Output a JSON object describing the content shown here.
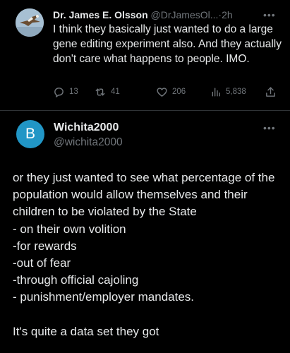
{
  "tweet1": {
    "author_name": "Dr. James E. Olsson",
    "handle": "@DrJamesOl...",
    "separator": "·",
    "time": "2h",
    "more_icon": "more-horizontal-icon",
    "text": "I think they basically just wanted to do a large gene editing experiment also. And they actually don't care what happens to people. IMO.",
    "actions": {
      "replies": "13",
      "retweets": "41",
      "likes": "206",
      "views": "5,838"
    }
  },
  "tweet2": {
    "avatar_letter": "B",
    "author_name": "Wichita2000",
    "handle": "@wichita2000",
    "more_icon": "more-horizontal-icon",
    "text": "or they just wanted to see what percentage of the population would allow themselves and their children to be violated by the State\n- on their own volition\n-for rewards\n-out of fear\n-through official cajoling\n- punishment/employer mandates.\n\nIt's quite a data set they got"
  },
  "colors": {
    "background": "#000000",
    "primary_text": "#e7e9ea",
    "secondary_text": "#71767b",
    "avatar2_bg": "#2196c6",
    "divider": "#2f3336"
  }
}
